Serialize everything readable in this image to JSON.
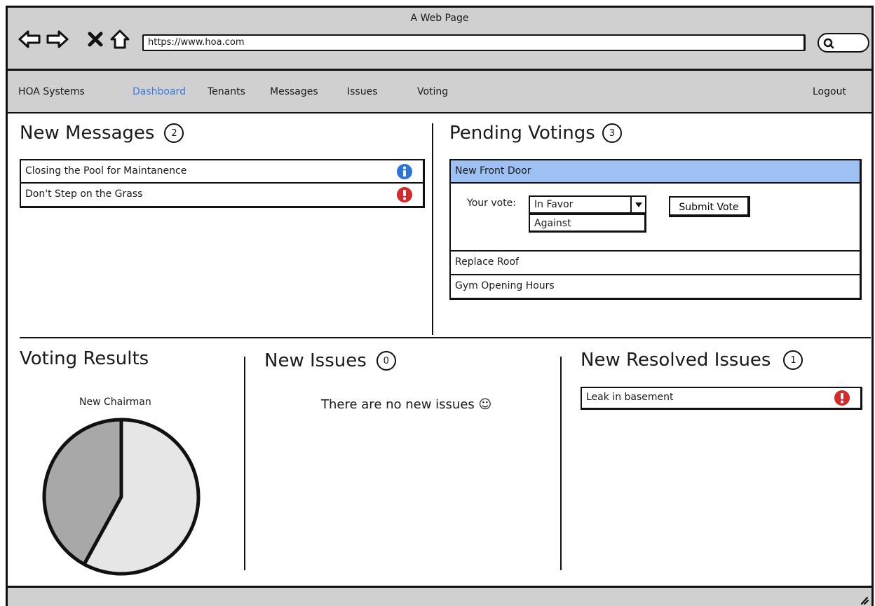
{
  "window": {
    "title": "A Web Page"
  },
  "browser": {
    "url": "https://www.hoa.com"
  },
  "nav": {
    "brand": "HOA Systems",
    "items": [
      "Dashboard",
      "Tenants",
      "Messages",
      "Issues",
      "Voting"
    ],
    "active": "Dashboard",
    "logout": "Logout"
  },
  "messages": {
    "title": "New Messages",
    "count": "2",
    "items": [
      {
        "text": "Closing the Pool for Maintanence",
        "icon": "info-icon"
      },
      {
        "text": "Don't Step on the Grass",
        "icon": "alert-icon"
      }
    ]
  },
  "votings": {
    "title": "Pending Votings",
    "count": "3",
    "items": [
      "New Front Door",
      "Replace Roof",
      "Gym Opening Hours"
    ],
    "your_vote_label": "Your vote:",
    "selected": "In Favor",
    "option": "Against",
    "submit_label": "Submit Vote"
  },
  "results": {
    "title": "Voting Results",
    "caption": "New Chairman"
  },
  "issues": {
    "title": "New Issues",
    "count": "0",
    "empty_text": "There are no new issues ☺"
  },
  "resolved": {
    "title": "New Resolved Issues",
    "count": "1",
    "items": [
      {
        "text": "Leak in basement",
        "icon": "alert-icon"
      }
    ]
  },
  "colors": {
    "chrome": "#d0d0d0",
    "active_link": "#3b7ad9",
    "selected_row": "#9fc0f3",
    "info": "#2f73d6",
    "alert": "#d42a2a"
  },
  "chart_data": {
    "type": "pie",
    "title": "New Chairman",
    "values": [
      58,
      42
    ],
    "colors": [
      "#e6e6e6",
      "#a8a8a8"
    ]
  }
}
